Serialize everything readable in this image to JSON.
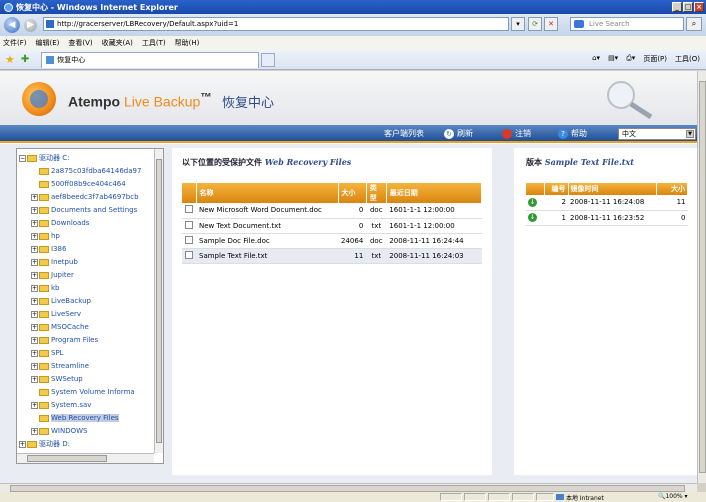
{
  "window": {
    "title": "恢复中心 - Windows Internet Explorer"
  },
  "address": {
    "url": "http://gracerserver/LBRecovery/Default.aspx?uid=1"
  },
  "search": {
    "placeholder": "Live Search"
  },
  "menu": [
    "文件(F)",
    "编辑(E)",
    "查看(V)",
    "收藏夹(A)",
    "工具(T)",
    "帮助(H)"
  ],
  "tab": {
    "label": "恢复中心"
  },
  "ie_tools": {
    "page": "页面(P)",
    "tools": "工具(O)"
  },
  "header": {
    "brand_main": "Atempo",
    "brand_live": "Live Backup",
    "brand_tm": "™",
    "page_title": "恢复中心"
  },
  "toolbar": {
    "clients": "客户端列表",
    "refresh": "刷新",
    "logout": "注销",
    "help": "帮助",
    "language": "中文"
  },
  "tree": {
    "nodes": [
      {
        "label": "驱动器 C:",
        "level": 0,
        "toggle": "-"
      },
      {
        "label": "2a875c03fdba64146da97",
        "level": 1,
        "toggle": ""
      },
      {
        "label": "500ff08b9ce404c464",
        "level": 1,
        "toggle": ""
      },
      {
        "label": "aef8beedc3f7ab4697bcb",
        "level": 1,
        "toggle": "+"
      },
      {
        "label": "Documents and Settings",
        "level": 1,
        "toggle": "+"
      },
      {
        "label": "Downloads",
        "level": 1,
        "toggle": "+"
      },
      {
        "label": "hp",
        "level": 1,
        "toggle": "+"
      },
      {
        "label": "I386",
        "level": 1,
        "toggle": "+"
      },
      {
        "label": "Inetpub",
        "level": 1,
        "toggle": "+"
      },
      {
        "label": "Jupiter",
        "level": 1,
        "toggle": "+"
      },
      {
        "label": "kb",
        "level": 1,
        "toggle": "+"
      },
      {
        "label": "LiveBackup",
        "level": 1,
        "toggle": "+"
      },
      {
        "label": "LiveServ",
        "level": 1,
        "toggle": "+"
      },
      {
        "label": "MSOCache",
        "level": 1,
        "toggle": "+"
      },
      {
        "label": "Program Files",
        "level": 1,
        "toggle": "+"
      },
      {
        "label": "SPL",
        "level": 1,
        "toggle": "+"
      },
      {
        "label": "Streamline",
        "level": 1,
        "toggle": "+"
      },
      {
        "label": "SWSetup",
        "level": 1,
        "toggle": "+"
      },
      {
        "label": "System Volume Informa",
        "level": 1,
        "toggle": ""
      },
      {
        "label": "System.sav",
        "level": 1,
        "toggle": "+"
      },
      {
        "label": "Web Recovery Files",
        "level": 1,
        "toggle": "",
        "selected": true
      },
      {
        "label": "WINDOWS",
        "level": 1,
        "toggle": "+"
      },
      {
        "label": "驱动器 D:",
        "level": 0,
        "toggle": "+"
      }
    ]
  },
  "files": {
    "title_prefix": "以下位置的受保护文件",
    "title_folder": "Web Recovery Files",
    "columns": [
      "名称",
      "大小",
      "类型",
      "最近日期"
    ],
    "rows": [
      {
        "name": "New Microsoft Word Document.doc",
        "size": "0",
        "type": "doc",
        "date": "1601-1-1 12:00:00"
      },
      {
        "name": "New Text Document.txt",
        "size": "0",
        "type": "txt",
        "date": "1601-1-1 12:00:00"
      },
      {
        "name": "Sample Doc File.doc",
        "size": "24064",
        "type": "doc",
        "date": "2008-11-11 16:24:44"
      },
      {
        "name": "Sample Text File.txt",
        "size": "11",
        "type": "txt",
        "date": "2008-11-11 16:24:03",
        "highlight": true
      }
    ]
  },
  "versions": {
    "title_prefix": "版本",
    "title_file": "Sample Text File.txt",
    "columns": [
      "",
      "编号",
      "镜像时间",
      "大小"
    ],
    "rows": [
      {
        "num": "2",
        "time": "2008-11-11 16:24:08",
        "size": "11"
      },
      {
        "num": "1",
        "time": "2008-11-11 16:23:52",
        "size": "0"
      }
    ]
  },
  "status": {
    "zone": "本地 Intranet",
    "zoom": "100%"
  },
  "colors": {
    "accent": "#f0a020",
    "toolbar": "#1f4f95",
    "link": "#2050b0"
  }
}
